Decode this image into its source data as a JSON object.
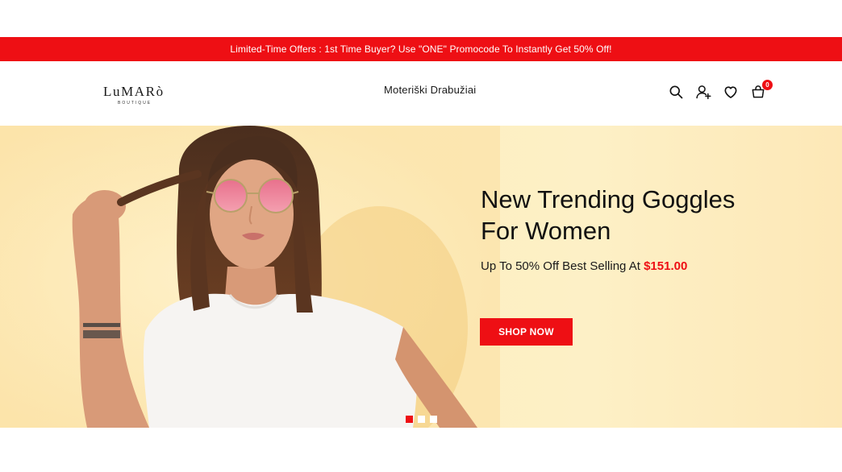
{
  "promo": {
    "text": "Limited-Time Offers : 1st Time Buyer? Use \"ONE\" Promocode To Instantly Get 50% Off!"
  },
  "header": {
    "logo": {
      "main": "LuMARò",
      "sub": "BOUTIQUE"
    },
    "nav": [
      {
        "label": "Moteriški Drabužiai"
      }
    ],
    "icons": [
      "search-icon",
      "account-icon",
      "wishlist-icon",
      "cart-icon"
    ],
    "cart_count": "0"
  },
  "hero": {
    "title_line1": "New Trending Goggles",
    "title_line2": "For Women",
    "subtitle_prefix": "Up To 50% Off Best Selling At",
    "price": "$151.00",
    "button_label": "SHOP NOW",
    "slides": 3,
    "active_slide": 1
  },
  "colors": {
    "accent": "#ee0f14",
    "hero_bg": "#fdeebf",
    "text": "#111111"
  }
}
